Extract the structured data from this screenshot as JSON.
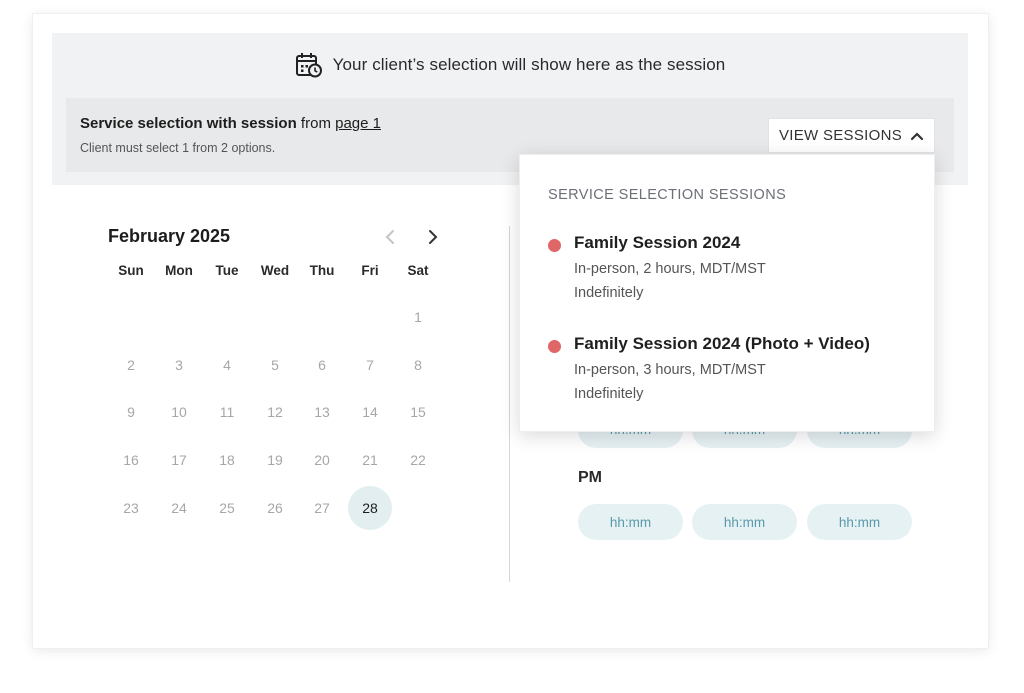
{
  "banner": {
    "message": "Your client’s selection will show here as the session",
    "icon": "calendar-clock-icon"
  },
  "selection": {
    "title_bold": "Service selection with session",
    "title_from": " from ",
    "page_link": "page 1",
    "subtitle": "Client must select 1 from 2 options.",
    "view_button": "VIEW SESSIONS"
  },
  "calendar": {
    "month": "February 2025",
    "weekdays": [
      "Sun",
      "Mon",
      "Tue",
      "Wed",
      "Thu",
      "Fri",
      "Sat"
    ],
    "days": [
      "1",
      "2",
      "3",
      "4",
      "5",
      "6",
      "7",
      "8",
      "9",
      "10",
      "11",
      "12",
      "13",
      "14",
      "15",
      "16",
      "17",
      "18",
      "19",
      "20",
      "21",
      "22",
      "23",
      "24",
      "25",
      "26",
      "27",
      "28"
    ],
    "selected_day": "28"
  },
  "times": {
    "pm_label": "PM",
    "slot_placeholder": "hh:mm"
  },
  "dropdown": {
    "title": "SERVICE SELECTION SESSIONS",
    "options": [
      {
        "name": "Family Session 2024",
        "details": "In-person, 2 hours, MDT/MST",
        "duration": "Indefinitely",
        "color": "#e06767"
      },
      {
        "name": "Family Session 2024 (Photo + Video)",
        "details": "In-person, 3 hours, MDT/MST",
        "duration": "Indefinitely",
        "color": "#e06767"
      }
    ]
  },
  "colors": {
    "slot_bg": "#e6f1f4",
    "slot_text": "#5a9aaa",
    "dot": "#e06767"
  }
}
